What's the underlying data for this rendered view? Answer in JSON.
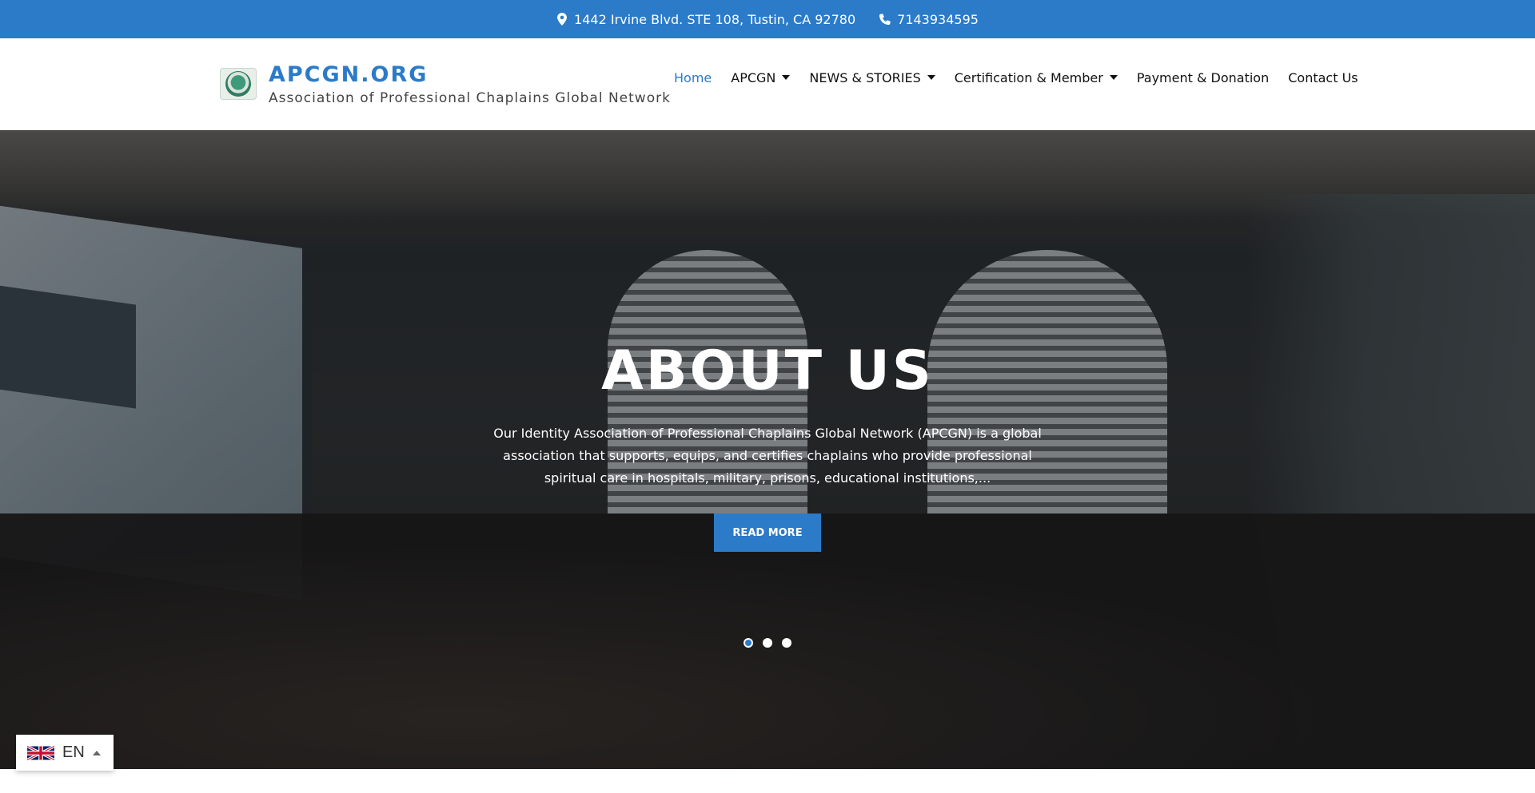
{
  "topbar": {
    "address": "1442 Irvine Blvd. STE 108, Tustin, CA 92780",
    "phone": "7143934595"
  },
  "header": {
    "site_title": "APCGN.ORG",
    "tagline": "Association of Professional Chaplains Global Network"
  },
  "nav": {
    "items": [
      {
        "label": "Home",
        "active": true
      },
      {
        "label": "APCGN",
        "has_dropdown": true
      },
      {
        "label": "NEWS & STORIES",
        "has_dropdown": true
      },
      {
        "label": "Certification & Member",
        "has_dropdown": true
      },
      {
        "label": "Payment & Donation"
      },
      {
        "label": "Contact Us"
      }
    ]
  },
  "hero": {
    "title": "ABOUT US",
    "text": "Our Identity Association of Professional Chaplains Global Network (APCGN) is a global association that supports, equips, and certifies chaplains who provide professional spiritual care in hospitals, military, prisons, educational institutions,...",
    "button": "READ MORE",
    "slides": 3,
    "active_slide": 1
  },
  "language": {
    "code": "EN"
  },
  "colors": {
    "accent": "#2b7bc9",
    "topbar": "#2b7bc9",
    "text": "#111111"
  },
  "icons": {
    "address": "map-marker-icon",
    "phone": "phone-icon",
    "language_flag": "uk-flag-icon"
  }
}
